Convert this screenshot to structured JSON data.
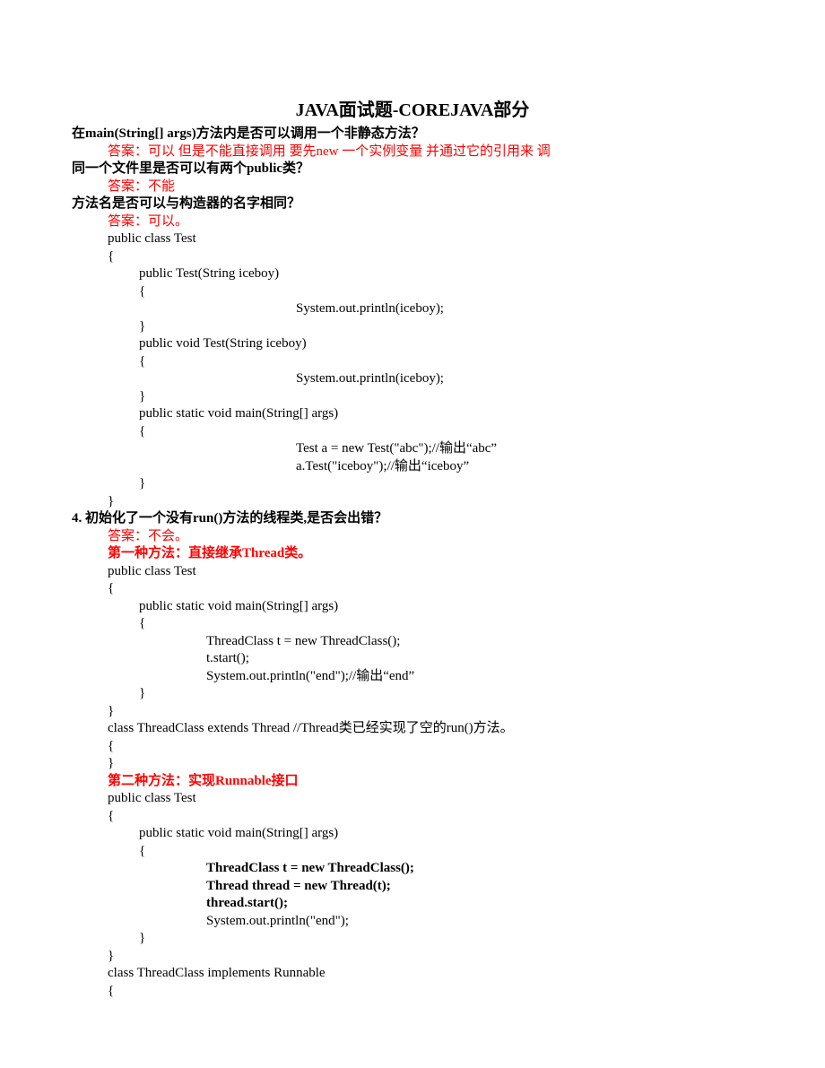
{
  "title": "JAVA面试题-COREJAVA部分",
  "q1": "在main(String[] args)方法内是否可以调用一个非静态方法？",
  "a1": "答案：可以 但是不能直接调用 要先new 一个实例变量 并通过它的引用来 调",
  "q2": "同一个文件里是否可以有两个public类？",
  "a2": "答案：不能",
  "q3": "方法名是否可以与构造器的名字相同？",
  "a3": "答案：可以。",
  "code3": {
    "l1": "public class Test",
    "l2": "{",
    "l3": "public Test(String iceboy)",
    "l4": "{",
    "l5": "System.out.println(iceboy);",
    "l6": "}",
    "l7": "public void Test(String iceboy)",
    "l8": "{",
    "l9": "System.out.println(iceboy);",
    "l10": "}",
    "l11": "public static void main(String[] args)",
    "l12": "{",
    "l13": "Test a = new Test(\"abc\");//输出“abc”",
    "l14": "a.Test(\"iceboy\");//输出“iceboy”",
    "l15": "}",
    "l16": "}"
  },
  "q4": "4. 初始化了一个没有run()方法的线程类,是否会出错？",
  "a4": "答案：不会。",
  "m4a": "第一种方法：直接继承Thread类。",
  "code4a": {
    "l1": "public class Test",
    "l2": "{",
    "l3": "public static void main(String[] args)",
    "l4": "{",
    "l5": "ThreadClass t = new ThreadClass();",
    "l6": "t.start();",
    "l7": "System.out.println(\"end\");//输出“end”",
    "l8": "}",
    "l9": "}",
    "l10": "class ThreadClass extends Thread   //Thread类已经实现了空的run()方法。",
    "l11": "{",
    "l12": "}"
  },
  "m4b": "第二种方法：实现Runnable接口",
  "code4b": {
    "l1": "public class Test",
    "l2": "{",
    "l3": "public static void main(String[] args)",
    "l4": "{",
    "l5": "ThreadClass t = new ThreadClass();",
    "l6": "Thread thread = new Thread(t);",
    "l7": "thread.start();",
    "l8": "System.out.println(\"end\");",
    "l9": "}",
    "l10": "}",
    "l11": "class ThreadClass implements Runnable",
    "l12": "{"
  }
}
